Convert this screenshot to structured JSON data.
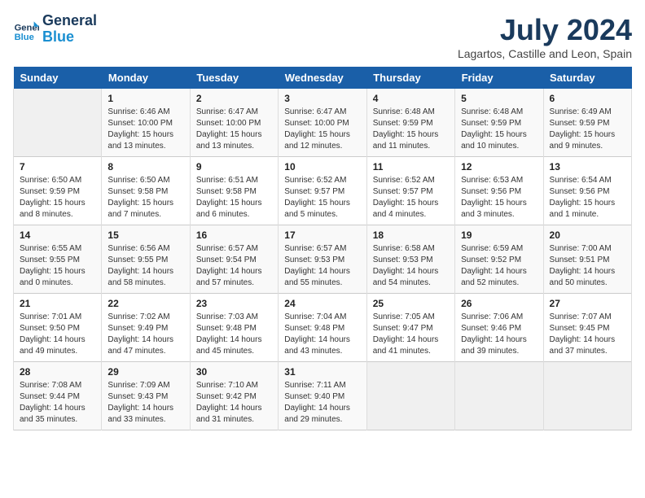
{
  "logo": {
    "line1": "General",
    "line2": "Blue"
  },
  "title": "July 2024",
  "subtitle": "Lagartos, Castille and Leon, Spain",
  "weekdays": [
    "Sunday",
    "Monday",
    "Tuesday",
    "Wednesday",
    "Thursday",
    "Friday",
    "Saturday"
  ],
  "weeks": [
    [
      {
        "day": "",
        "info": ""
      },
      {
        "day": "1",
        "info": "Sunrise: 6:46 AM\nSunset: 10:00 PM\nDaylight: 15 hours\nand 13 minutes."
      },
      {
        "day": "2",
        "info": "Sunrise: 6:47 AM\nSunset: 10:00 PM\nDaylight: 15 hours\nand 13 minutes."
      },
      {
        "day": "3",
        "info": "Sunrise: 6:47 AM\nSunset: 10:00 PM\nDaylight: 15 hours\nand 12 minutes."
      },
      {
        "day": "4",
        "info": "Sunrise: 6:48 AM\nSunset: 9:59 PM\nDaylight: 15 hours\nand 11 minutes."
      },
      {
        "day": "5",
        "info": "Sunrise: 6:48 AM\nSunset: 9:59 PM\nDaylight: 15 hours\nand 10 minutes."
      },
      {
        "day": "6",
        "info": "Sunrise: 6:49 AM\nSunset: 9:59 PM\nDaylight: 15 hours\nand 9 minutes."
      }
    ],
    [
      {
        "day": "7",
        "info": "Sunrise: 6:50 AM\nSunset: 9:59 PM\nDaylight: 15 hours\nand 8 minutes."
      },
      {
        "day": "8",
        "info": "Sunrise: 6:50 AM\nSunset: 9:58 PM\nDaylight: 15 hours\nand 7 minutes."
      },
      {
        "day": "9",
        "info": "Sunrise: 6:51 AM\nSunset: 9:58 PM\nDaylight: 15 hours\nand 6 minutes."
      },
      {
        "day": "10",
        "info": "Sunrise: 6:52 AM\nSunset: 9:57 PM\nDaylight: 15 hours\nand 5 minutes."
      },
      {
        "day": "11",
        "info": "Sunrise: 6:52 AM\nSunset: 9:57 PM\nDaylight: 15 hours\nand 4 minutes."
      },
      {
        "day": "12",
        "info": "Sunrise: 6:53 AM\nSunset: 9:56 PM\nDaylight: 15 hours\nand 3 minutes."
      },
      {
        "day": "13",
        "info": "Sunrise: 6:54 AM\nSunset: 9:56 PM\nDaylight: 15 hours\nand 1 minute."
      }
    ],
    [
      {
        "day": "14",
        "info": "Sunrise: 6:55 AM\nSunset: 9:55 PM\nDaylight: 15 hours\nand 0 minutes."
      },
      {
        "day": "15",
        "info": "Sunrise: 6:56 AM\nSunset: 9:55 PM\nDaylight: 14 hours\nand 58 minutes."
      },
      {
        "day": "16",
        "info": "Sunrise: 6:57 AM\nSunset: 9:54 PM\nDaylight: 14 hours\nand 57 minutes."
      },
      {
        "day": "17",
        "info": "Sunrise: 6:57 AM\nSunset: 9:53 PM\nDaylight: 14 hours\nand 55 minutes."
      },
      {
        "day": "18",
        "info": "Sunrise: 6:58 AM\nSunset: 9:53 PM\nDaylight: 14 hours\nand 54 minutes."
      },
      {
        "day": "19",
        "info": "Sunrise: 6:59 AM\nSunset: 9:52 PM\nDaylight: 14 hours\nand 52 minutes."
      },
      {
        "day": "20",
        "info": "Sunrise: 7:00 AM\nSunset: 9:51 PM\nDaylight: 14 hours\nand 50 minutes."
      }
    ],
    [
      {
        "day": "21",
        "info": "Sunrise: 7:01 AM\nSunset: 9:50 PM\nDaylight: 14 hours\nand 49 minutes."
      },
      {
        "day": "22",
        "info": "Sunrise: 7:02 AM\nSunset: 9:49 PM\nDaylight: 14 hours\nand 47 minutes."
      },
      {
        "day": "23",
        "info": "Sunrise: 7:03 AM\nSunset: 9:48 PM\nDaylight: 14 hours\nand 45 minutes."
      },
      {
        "day": "24",
        "info": "Sunrise: 7:04 AM\nSunset: 9:48 PM\nDaylight: 14 hours\nand 43 minutes."
      },
      {
        "day": "25",
        "info": "Sunrise: 7:05 AM\nSunset: 9:47 PM\nDaylight: 14 hours\nand 41 minutes."
      },
      {
        "day": "26",
        "info": "Sunrise: 7:06 AM\nSunset: 9:46 PM\nDaylight: 14 hours\nand 39 minutes."
      },
      {
        "day": "27",
        "info": "Sunrise: 7:07 AM\nSunset: 9:45 PM\nDaylight: 14 hours\nand 37 minutes."
      }
    ],
    [
      {
        "day": "28",
        "info": "Sunrise: 7:08 AM\nSunset: 9:44 PM\nDaylight: 14 hours\nand 35 minutes."
      },
      {
        "day": "29",
        "info": "Sunrise: 7:09 AM\nSunset: 9:43 PM\nDaylight: 14 hours\nand 33 minutes."
      },
      {
        "day": "30",
        "info": "Sunrise: 7:10 AM\nSunset: 9:42 PM\nDaylight: 14 hours\nand 31 minutes."
      },
      {
        "day": "31",
        "info": "Sunrise: 7:11 AM\nSunset: 9:40 PM\nDaylight: 14 hours\nand 29 minutes."
      },
      {
        "day": "",
        "info": ""
      },
      {
        "day": "",
        "info": ""
      },
      {
        "day": "",
        "info": ""
      }
    ]
  ]
}
